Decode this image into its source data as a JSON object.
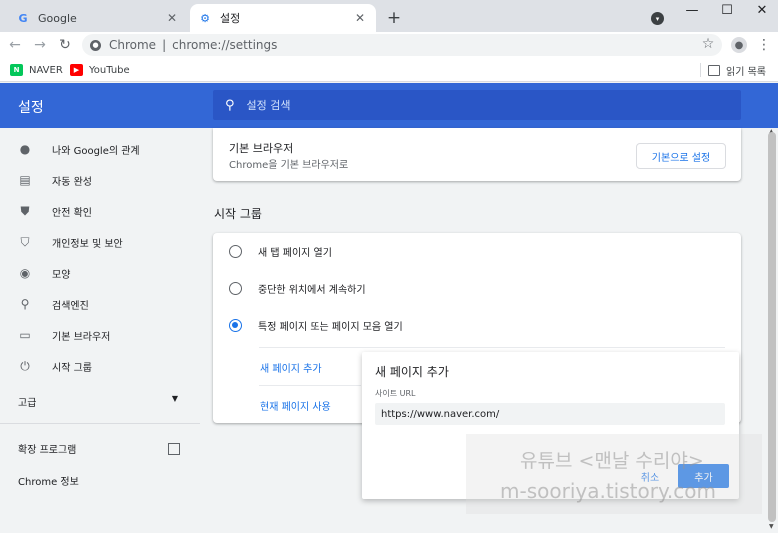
{
  "tabs": [
    {
      "label": "Google",
      "favicon": "google-g-icon",
      "favicon_char": "G",
      "favicon_color": "#4285f4"
    },
    {
      "label": "설정",
      "favicon": "gear-icon",
      "favicon_char": "⚙",
      "favicon_color": "#1a73e8"
    }
  ],
  "toolbar": {
    "site_label": "Chrome",
    "url": "chrome://settings"
  },
  "bookmarks": [
    {
      "label": "NAVER",
      "icon": "naver-icon",
      "icon_char": "N",
      "color": "#03c75a"
    },
    {
      "label": "YouTube",
      "icon": "youtube-icon",
      "icon_char": "▶",
      "color": "#ff0000"
    }
  ],
  "reading_list": {
    "label": "읽기 목록"
  },
  "header": {
    "title": "설정",
    "search_placeholder": "설정 검색",
    "color": "#3367d6"
  },
  "sidebar": {
    "items": [
      {
        "label": "나와 Google의 관계",
        "icon": "person-icon",
        "icon_char": "●"
      },
      {
        "label": "자동 완성",
        "icon": "clipboard-icon",
        "icon_char": "▤"
      },
      {
        "label": "안전 확인",
        "icon": "shield-check-icon",
        "icon_char": "⛊"
      },
      {
        "label": "개인정보 및 보안",
        "icon": "shield-icon",
        "icon_char": "⛉"
      },
      {
        "label": "모양",
        "icon": "palette-icon",
        "icon_char": "◉"
      },
      {
        "label": "검색엔진",
        "icon": "search-icon",
        "icon_char": "⚲"
      },
      {
        "label": "기본 브라우저",
        "icon": "browser-icon",
        "icon_char": "▭"
      },
      {
        "label": "시작 그룹",
        "icon": "power-icon",
        "icon_char": "⏻"
      }
    ],
    "advanced_label": "고급",
    "extensions_label": "확장 프로그램",
    "about_label": "Chrome 정보"
  },
  "default_browser": {
    "title": "기본 브라우저",
    "subtitle": "Chrome을 기본 브라우저로",
    "button_label": "기본으로 설정"
  },
  "startup": {
    "section_title": "시작 그룹",
    "options": [
      {
        "label": "새 탭 페이지 열기",
        "checked": false
      },
      {
        "label": "중단한 위치에서 계속하기",
        "checked": false
      },
      {
        "label": "특정 페이지 또는 페이지 모음 열기",
        "checked": true
      }
    ],
    "add_page_link": "새 페이지 추가",
    "use_current_link": "현재 페이지 사용"
  },
  "dialog": {
    "title": "새 페이지 추가",
    "field_label": "사이트 URL",
    "field_value": "https://www.naver.com/",
    "cancel_label": "취소",
    "add_label": "추가"
  },
  "watermark": {
    "line1": "유튜브 <맨날 수리야>",
    "line2": "m-sooriya.tistory.com"
  }
}
